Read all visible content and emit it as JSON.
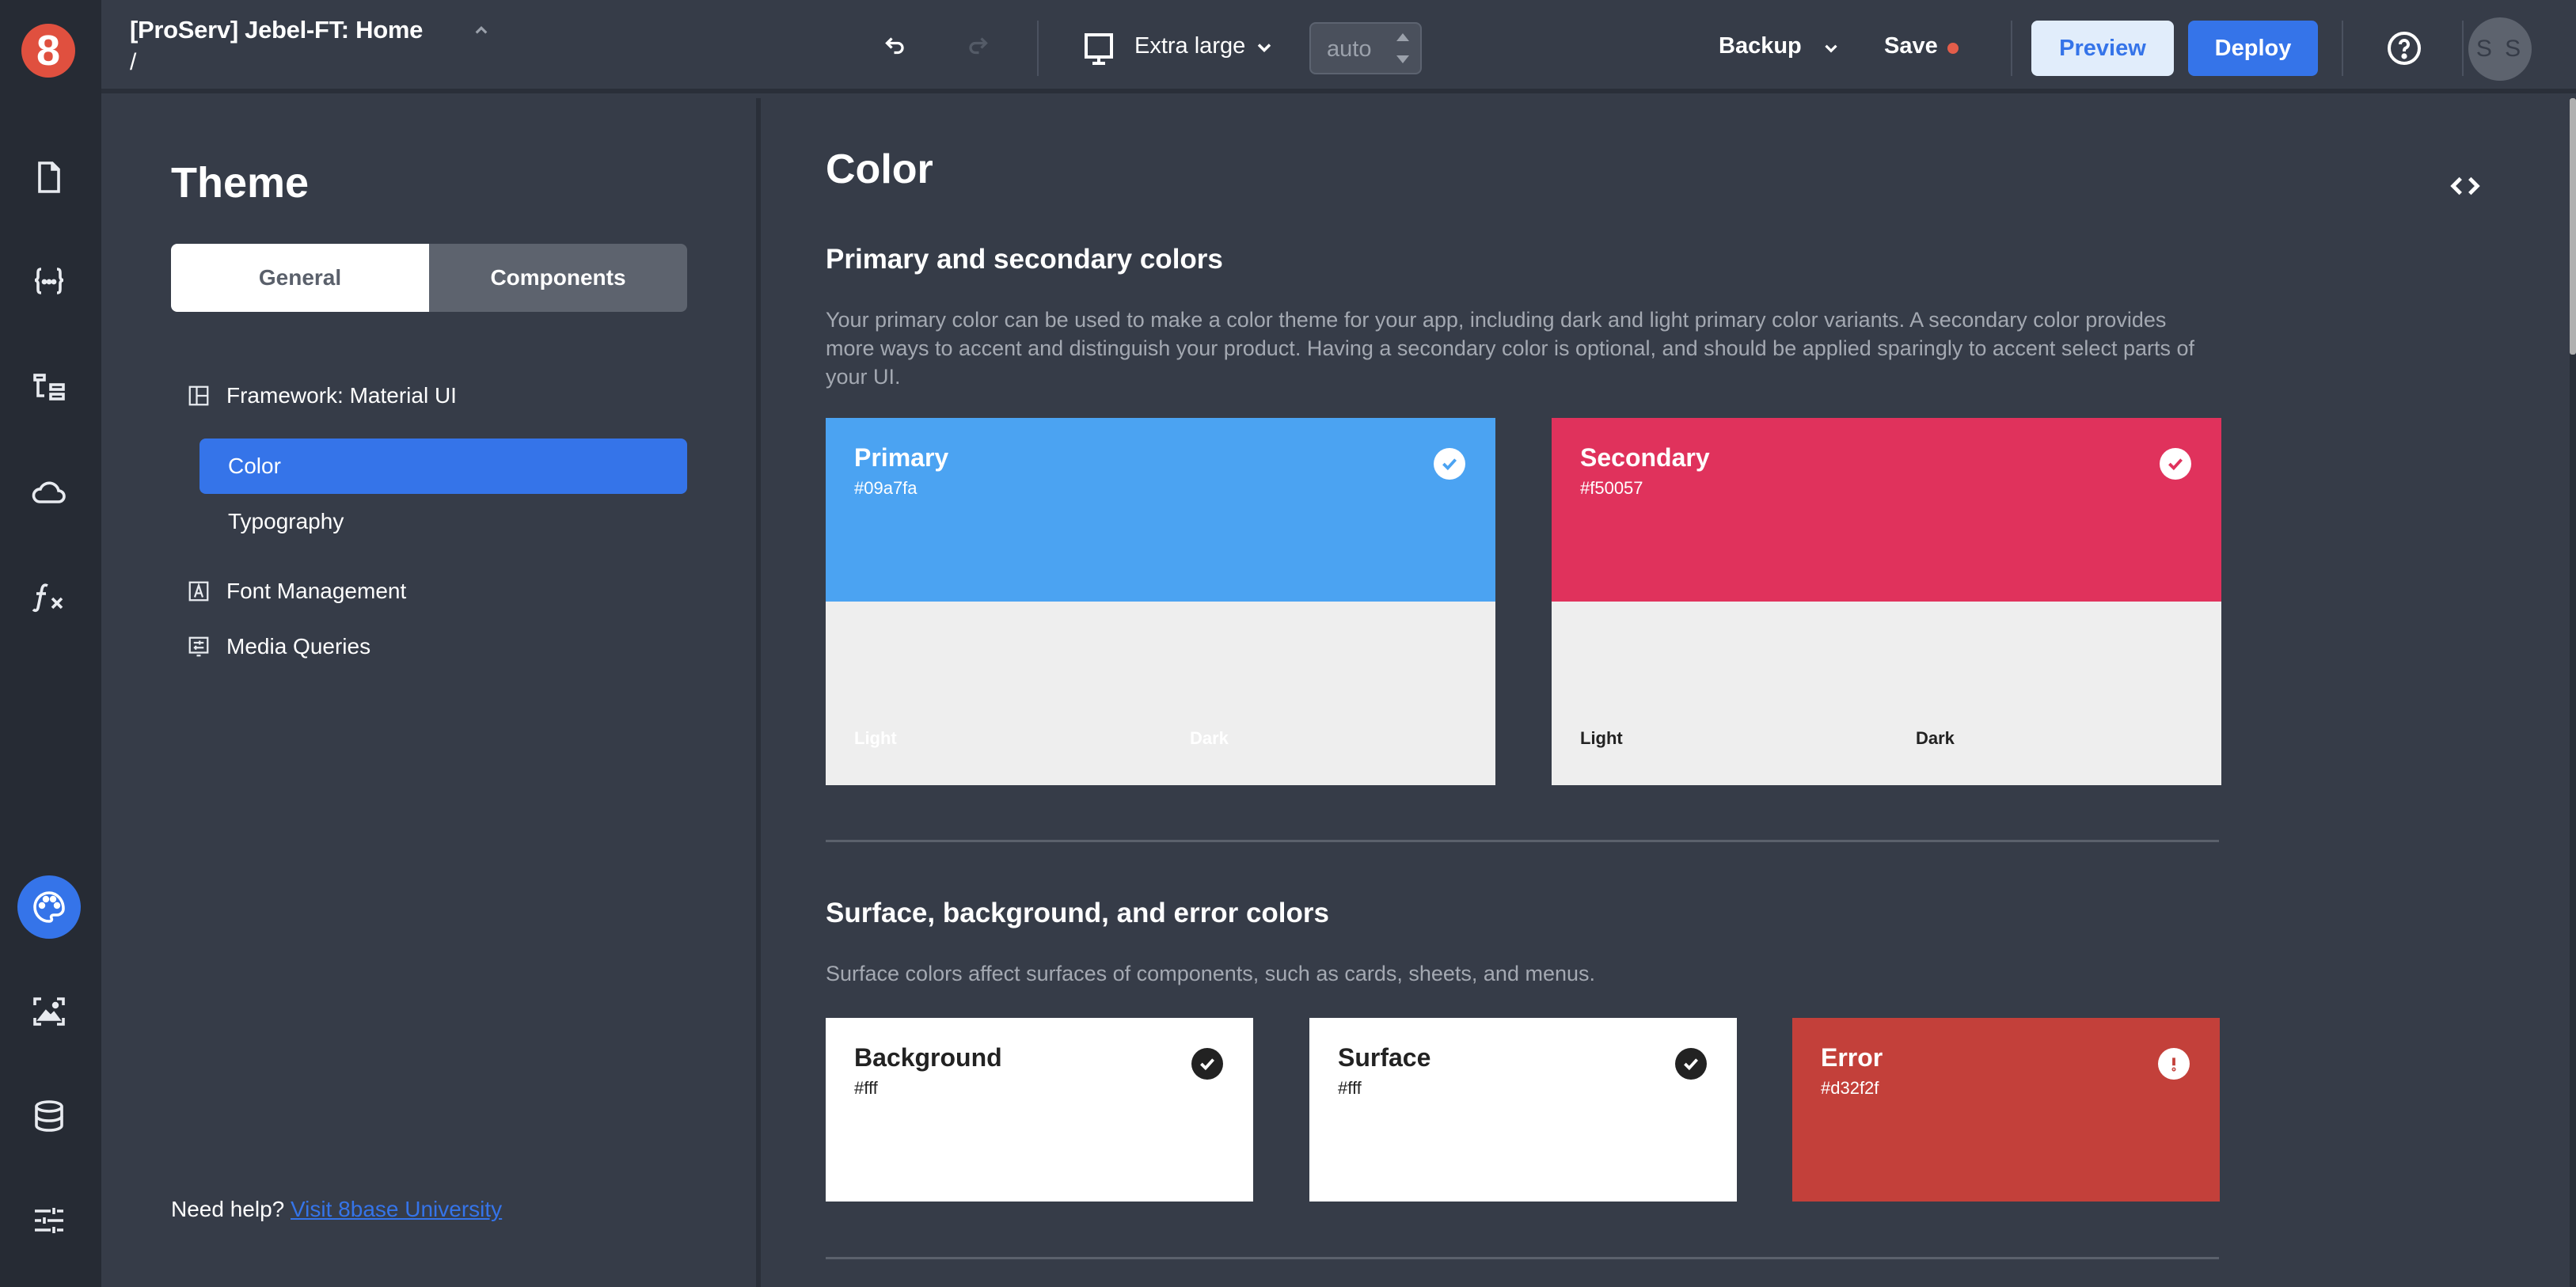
{
  "app": {
    "logo_text": "8",
    "project_title": "[ProServ] Jebel-FT: Home",
    "project_path": "/"
  },
  "rail": {
    "items": [
      {
        "name": "pages",
        "icon": "file-icon"
      },
      {
        "name": "state",
        "icon": "braces-icon"
      },
      {
        "name": "layout-tree",
        "icon": "tree-icon"
      },
      {
        "name": "resources",
        "icon": "cloud-icon"
      },
      {
        "name": "functions",
        "icon": "function-icon"
      },
      {
        "name": "theme",
        "icon": "palette-icon",
        "active": true
      },
      {
        "name": "assets",
        "icon": "image-icon"
      },
      {
        "name": "data",
        "icon": "database-icon"
      },
      {
        "name": "settings",
        "icon": "sliders-icon"
      }
    ]
  },
  "toolbar": {
    "undo_label": "Undo",
    "redo_label": "Redo",
    "device": "Extra large",
    "width_value": "auto",
    "backup_label": "Backup",
    "save_label": "Save",
    "preview_label": "Preview",
    "deploy_label": "Deploy",
    "help_label": "?",
    "avatar_initials": "S S",
    "unsaved_dot_color": "#e35d4a"
  },
  "panel": {
    "title": "Theme",
    "tabs": [
      {
        "label": "General",
        "active": true
      },
      {
        "label": "Components",
        "active": false
      }
    ],
    "nav": {
      "framework": "Framework: Material UI",
      "color": "Color",
      "typography": "Typography",
      "font_management": "Font Management",
      "media_queries": "Media Queries"
    },
    "help_prefix": "Need help?",
    "help_link": "Visit 8base University"
  },
  "content": {
    "title": "Color",
    "primary_section": {
      "title": "Primary and secondary colors",
      "description": "Your primary color can be used to make a color theme for your app, including dark and light primary color variants. A secondary color provides more ways to accent and distinguish your product. Having a secondary color is optional, and should be applied sparingly to accent select parts of your UI."
    },
    "swatches": [
      {
        "name": "Primary",
        "hex": "#09a7fa",
        "display_color": "#4ba3f2",
        "light_label": "Light",
        "dark_label": "Dark",
        "status": "check"
      },
      {
        "name": "Secondary",
        "hex": "#f50057",
        "display_color": "#e0325c",
        "light_label": "Light",
        "dark_label": "Dark",
        "status": "check"
      }
    ],
    "surface_section": {
      "title": "Surface, background, and error colors",
      "description": "Surface colors affect surfaces of components, such as cards, sheets, and menus."
    },
    "cards": [
      {
        "name": "Background",
        "hex": "#fff",
        "display_color": "#ffffff",
        "status": "check"
      },
      {
        "name": "Surface",
        "hex": "#fff",
        "display_color": "#ffffff",
        "status": "check"
      },
      {
        "name": "Error",
        "hex": "#d32f2f",
        "display_color": "#c3403a",
        "status": "alert"
      }
    ]
  }
}
